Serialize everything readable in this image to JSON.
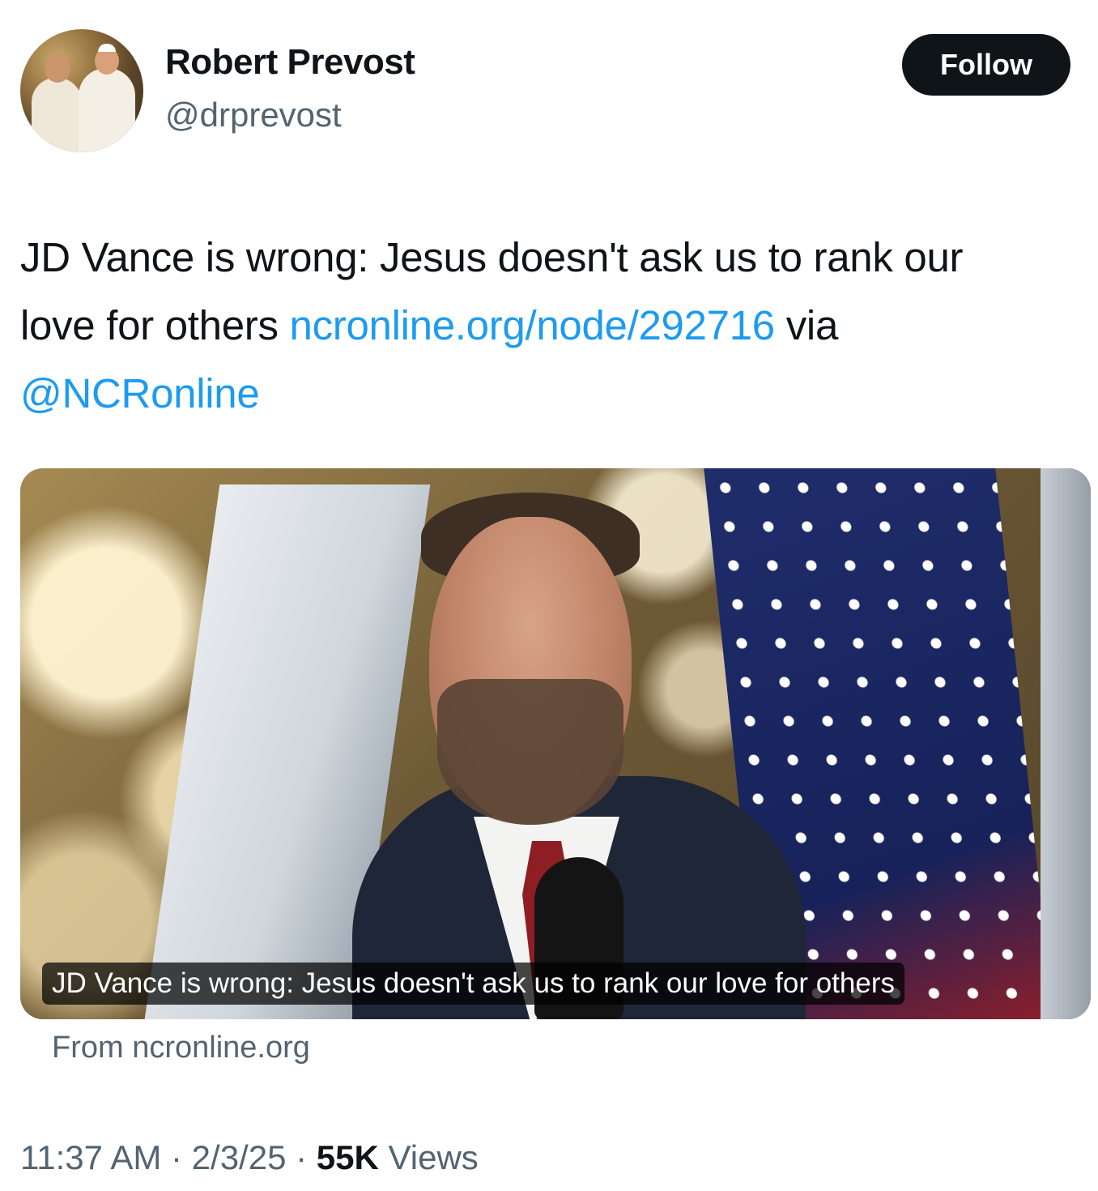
{
  "author": {
    "name": "Robert Prevost",
    "handle": "@drprevost"
  },
  "follow_label": "Follow",
  "tweet": {
    "line1": "JD Vance is wrong: Jesus doesn't ask us to rank our",
    "line2_text": "love for others ",
    "link": "ncronline.org/node/292716",
    "via": " via",
    "mention": "@NCRonline"
  },
  "card": {
    "caption": "JD Vance is wrong: Jesus doesn't ask us to rank our love for others",
    "source": "From ncronline.org"
  },
  "meta": {
    "time": "11:37 AM",
    "sep1": " · ",
    "date": "2/3/25",
    "sep2": " · ",
    "views_count": "55K",
    "views_label": " Views"
  }
}
